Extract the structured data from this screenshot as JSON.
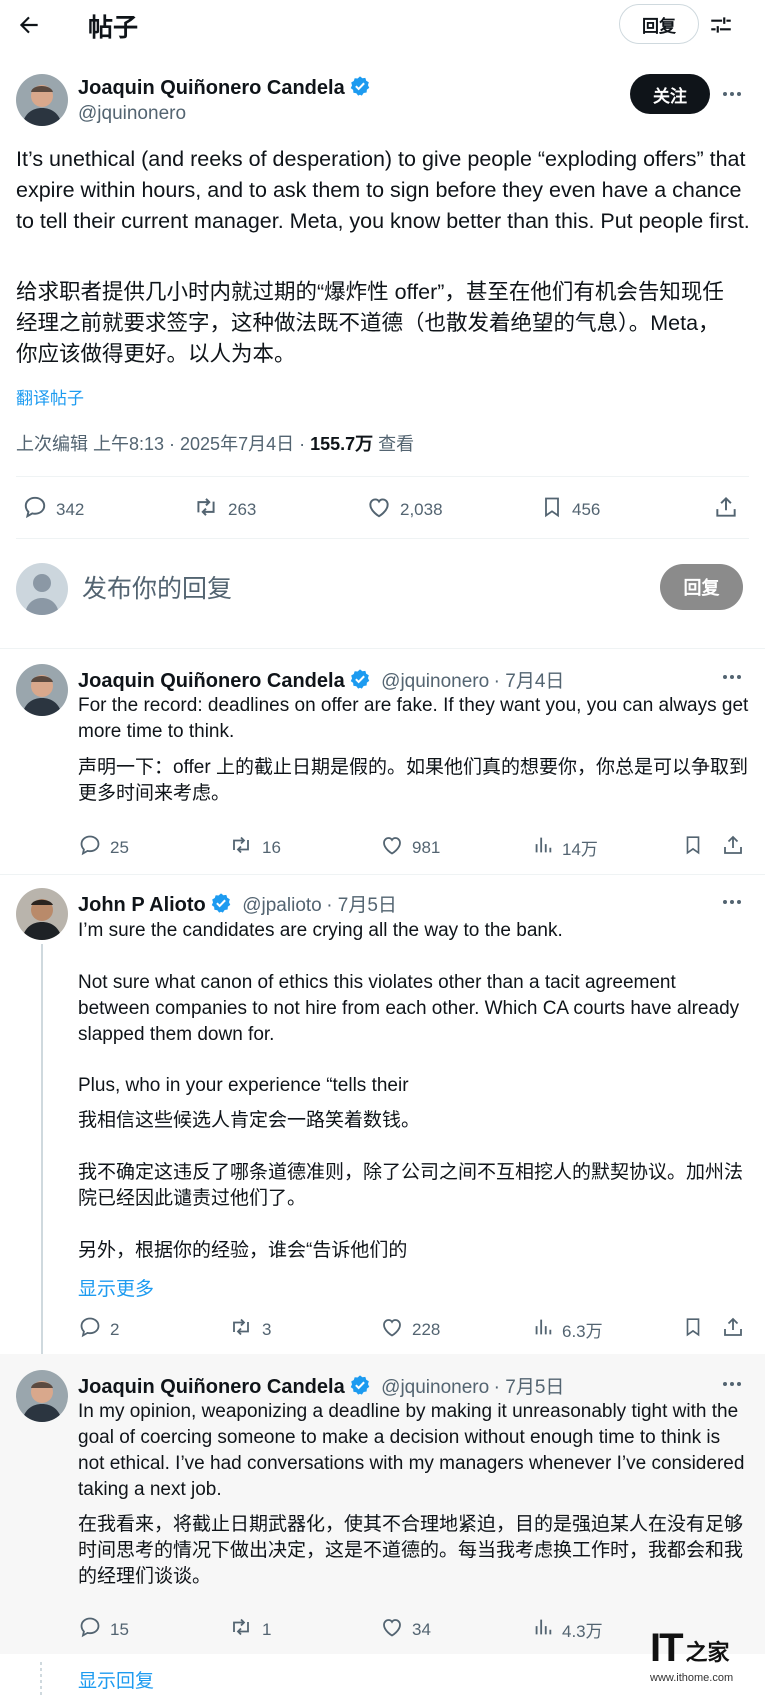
{
  "header": {
    "title": "帖子",
    "reply_button": "回复"
  },
  "main_post": {
    "author_name": "Joaquin Quiñonero Candela",
    "author_handle": "@jquinonero",
    "follow_label": "关注",
    "text_en": "It’s unethical (and reeks of desperation) to give people “exploding offers” that expire within hours, and to ask them to sign before they even have a chance to tell their current manager. Meta, you know better than this. Put people first.",
    "text_zh": "给求职者提供几小时内就过期的“爆炸性 offer”，甚至在他们有机会告知现任经理之前就要求签字，这种做法既不道德（也散发着绝望的气息）。Meta，你应该做得更好。以人为本。",
    "translate_label": "翻译帖子",
    "meta_prefix": "上次编辑 上午8:13 · 2025年7月4日 · ",
    "views": "155.7万",
    "views_suffix": " 查看",
    "replies": "342",
    "reposts": "263",
    "likes": "2,038",
    "bookmarks": "456"
  },
  "composer": {
    "placeholder": "发布你的回复",
    "button": "回复"
  },
  "replies": [
    {
      "author_name": "Joaquin Quiñonero Candela",
      "author_handle": "@jquinonero",
      "date": "· 7月4日",
      "text_en": "For the record: deadlines on offer are fake. If they want you, you can always get more time to think.",
      "text_zh": "声明一下：offer 上的截止日期是假的。如果他们真的想要你，你总是可以争取到更多时间来考虑。",
      "replies": "25",
      "reposts": "16",
      "likes": "981",
      "views": "14万"
    },
    {
      "author_name": "John P Alioto",
      "author_handle": "@jpalioto",
      "date": "· 7月5日",
      "text_en_1": "I’m sure the candidates are crying all the way to the bank.",
      "text_en_2": "Not sure what canon of ethics this violates other than a tacit agreement between companies to not hire from each other. Which CA courts have already slapped them down for.",
      "text_en_3": "Plus, who in your experience “tells their",
      "text_zh_1": "我相信这些候选人肯定会一路笑着数钱。",
      "text_zh_2": "我不确定这违反了哪条道德准则，除了公司之间不互相挖人的默契协议。加州法院已经因此谴责过他们了。",
      "text_zh_3": "另外，根据你的经验，谁会“告诉他们的",
      "show_more": "显示更多",
      "replies": "2",
      "reposts": "3",
      "likes": "228",
      "views": "6.3万"
    },
    {
      "author_name": "Joaquin Quiñonero Candela",
      "author_handle": "@jquinonero",
      "date": "· 7月5日",
      "text_en": "In my opinion, weaponizing a deadline by making it unreasonably tight with the goal of coercing someone to make a decision without enough time to think is not ethical. I’ve had conversations with my managers whenever I’ve considered taking a next job.",
      "text_zh": "在我看来，将截止日期武器化，使其不合理地紧迫，目的是强迫某人在没有足够时间思考的情况下做出决定，这是不道德的。每当我考虑换工作时，我都会和我的经理们谈谈。",
      "replies": "15",
      "reposts": "1",
      "likes": "34",
      "views": "4.3万"
    }
  ],
  "show_replies": "显示回复",
  "watermark": {
    "logo_left": "IT",
    "logo_right": "之家",
    "url": "www.ithome.com"
  },
  "colors": {
    "accent": "#1d9bf0",
    "text": "#0f1419",
    "muted": "#536471",
    "divider": "#eff3f4"
  }
}
